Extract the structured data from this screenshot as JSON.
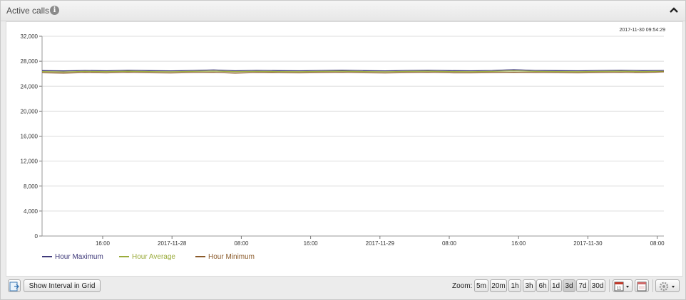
{
  "panel": {
    "title": "Active calls"
  },
  "chart": {
    "timestamp": "2017-11-30 09:54:29"
  },
  "chart_data": {
    "type": "line",
    "ylim": [
      0,
      32000
    ],
    "y_ticks": [
      "0",
      "4,000",
      "8,000",
      "12,000",
      "16,000",
      "20,000",
      "24,000",
      "28,000",
      "32,000"
    ],
    "x_ticks": [
      "16:00",
      "2017-11-28",
      "08:00",
      "16:00",
      "2017-11-29",
      "08:00",
      "16:00",
      "2017-11-30",
      "08:00"
    ],
    "grid": true,
    "legend_position": "bottom-left",
    "series": [
      {
        "name": "Hour Maximum",
        "color": "#3f3a7a",
        "values": [
          26500,
          26450,
          26520,
          26480,
          26550,
          26500,
          26470,
          26520,
          26600,
          26480,
          26530,
          26500,
          26480,
          26520,
          26560,
          26500,
          26470,
          26520,
          26550,
          26500,
          26480,
          26520,
          26650,
          26520,
          26500,
          26480,
          26520,
          26550,
          26500,
          26520
        ]
      },
      {
        "name": "Hour Average",
        "color": "#9aab3a",
        "values": [
          26350,
          26300,
          26380,
          26340,
          26400,
          26350,
          26320,
          26380,
          26420,
          26340,
          26380,
          26350,
          26330,
          26370,
          26400,
          26350,
          26320,
          26370,
          26400,
          26350,
          26330,
          26370,
          26450,
          26370,
          26350,
          26330,
          26370,
          26400,
          26350,
          26380
        ]
      },
      {
        "name": "Hour Minimum",
        "color": "#8a5a2a",
        "values": [
          26150,
          26100,
          26180,
          26140,
          26200,
          26150,
          26120,
          26180,
          26200,
          26100,
          26180,
          26150,
          26130,
          26170,
          26200,
          26150,
          26120,
          26170,
          26200,
          26150,
          26130,
          26170,
          26220,
          26170,
          26150,
          26130,
          26170,
          26200,
          26150,
          26300
        ]
      }
    ]
  },
  "toolbar": {
    "show_interval_label": "Show Interval in Grid",
    "zoom_label": "Zoom:",
    "zoom_options": [
      "5m",
      "20m",
      "1h",
      "3h",
      "6h",
      "1d",
      "3d",
      "7d",
      "30d"
    ],
    "zoom_selected": "3d"
  },
  "icons": {
    "export": "export-icon",
    "calendar": "calendar-icon",
    "calendar_remove": "calendar-remove-icon",
    "settings": "gear-icon",
    "info": "info-icon",
    "collapse": "chevron-up-icon"
  }
}
